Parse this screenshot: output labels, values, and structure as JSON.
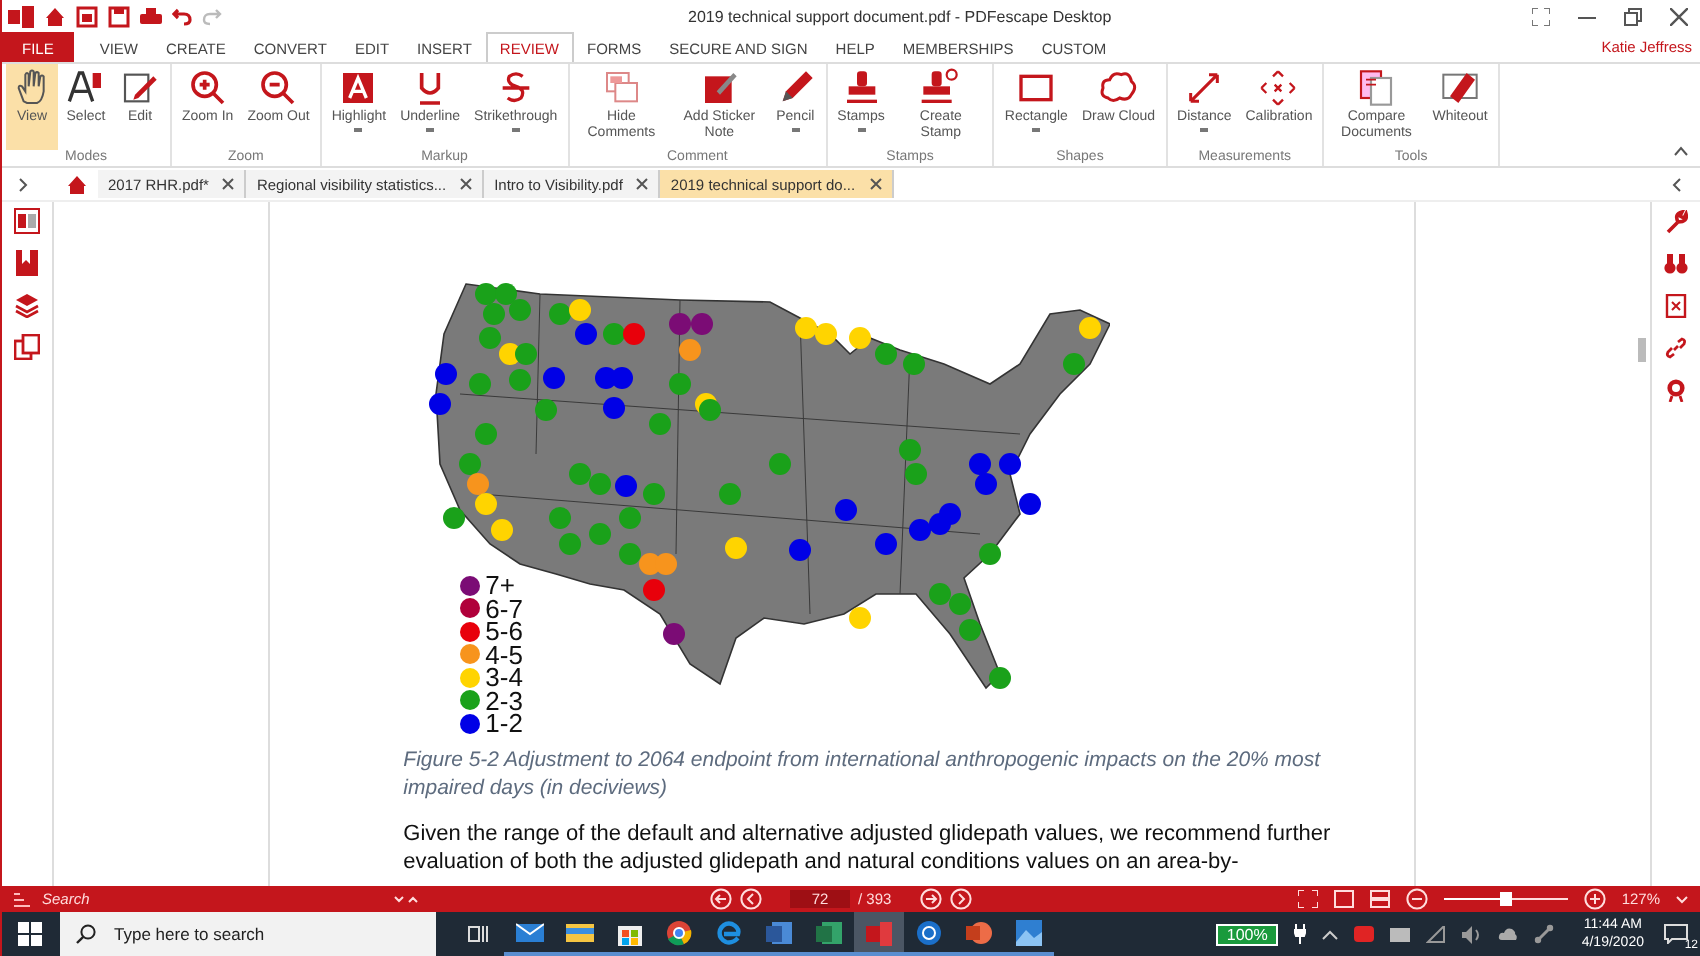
{
  "window": {
    "title": "2019 technical support document.pdf  -  PDFescape Desktop"
  },
  "menu": [
    {
      "label": "FILE",
      "kind": "file",
      "selected": false
    },
    {
      "label": "VIEW",
      "kind": "tab",
      "selected": false
    },
    {
      "label": "CREATE",
      "kind": "tab",
      "selected": false
    },
    {
      "label": "CONVERT",
      "kind": "tab",
      "selected": false
    },
    {
      "label": "EDIT",
      "kind": "tab",
      "selected": false
    },
    {
      "label": "INSERT",
      "kind": "tab",
      "selected": false
    },
    {
      "label": "REVIEW",
      "kind": "tab",
      "selected": true
    },
    {
      "label": "FORMS",
      "kind": "tab",
      "selected": false
    },
    {
      "label": "SECURE AND SIGN",
      "kind": "tab",
      "selected": false
    },
    {
      "label": "HELP",
      "kind": "tab",
      "selected": false
    },
    {
      "label": "MEMBERSHIPS",
      "kind": "tab",
      "selected": false
    },
    {
      "label": "CUSTOM",
      "kind": "tab",
      "selected": false
    }
  ],
  "user": "Katie Jeffress",
  "ribbon_groups": [
    {
      "label": "Modes",
      "tools": [
        {
          "label": "View",
          "kind": "hand",
          "selected": true,
          "dropdown": false
        },
        {
          "label": "Select",
          "kind": "select",
          "selected": false,
          "dropdown": false
        },
        {
          "label": "Edit",
          "kind": "edit",
          "selected": false,
          "dropdown": false
        }
      ]
    },
    {
      "label": "Zoom",
      "tools": [
        {
          "label": "Zoom In",
          "kind": "zoom-in",
          "selected": false,
          "dropdown": false
        },
        {
          "label": "Zoom Out",
          "kind": "zoom-out",
          "selected": false,
          "dropdown": false
        }
      ]
    },
    {
      "label": "Markup",
      "tools": [
        {
          "label": "Highlight",
          "kind": "highlight",
          "selected": false,
          "dropdown": true
        },
        {
          "label": "Underline",
          "kind": "underline",
          "selected": false,
          "dropdown": true
        },
        {
          "label": "Strikethrough",
          "kind": "strike",
          "selected": false,
          "dropdown": true
        }
      ]
    },
    {
      "label": "Comment",
      "tools": [
        {
          "label": "Hide Comments",
          "kind": "comments",
          "selected": false,
          "dropdown": false
        },
        {
          "label": "Add Sticker Note",
          "kind": "note",
          "selected": false,
          "dropdown": false
        },
        {
          "label": "Pencil",
          "kind": "pencil",
          "selected": false,
          "dropdown": true
        }
      ]
    },
    {
      "label": "Stamps",
      "tools": [
        {
          "label": "Stamps",
          "kind": "stamp",
          "selected": false,
          "dropdown": true
        },
        {
          "label": "Create Stamp",
          "kind": "create-stamp",
          "selected": false,
          "dropdown": false
        }
      ]
    },
    {
      "label": "Shapes",
      "tools": [
        {
          "label": "Rectangle",
          "kind": "rectangle",
          "selected": false,
          "dropdown": true
        },
        {
          "label": "Draw Cloud",
          "kind": "cloud",
          "selected": false,
          "dropdown": false
        }
      ]
    },
    {
      "label": "Measurements",
      "tools": [
        {
          "label": "Distance",
          "kind": "distance",
          "selected": false,
          "dropdown": true
        },
        {
          "label": "Calibration",
          "kind": "calibration",
          "selected": false,
          "dropdown": false
        }
      ]
    },
    {
      "label": "Tools",
      "tools": [
        {
          "label": "Compare Documents",
          "kind": "compare",
          "selected": false,
          "dropdown": false
        },
        {
          "label": "Whiteout",
          "kind": "whiteout",
          "selected": false,
          "dropdown": false
        }
      ]
    }
  ],
  "doc_tabs": [
    {
      "label": "2017 RHR.pdf*",
      "selected": false
    },
    {
      "label": "Regional visibility statistics...",
      "selected": false
    },
    {
      "label": "Intro to Visibility.pdf",
      "selected": false
    },
    {
      "label": "2019 technical support do...",
      "selected": true
    }
  ],
  "figure": {
    "legend": [
      {
        "label": "7+",
        "color": "#7b0c75"
      },
      {
        "label": "6-7",
        "color": "#b0003a"
      },
      {
        "label": "5-6",
        "color": "#e8000b"
      },
      {
        "label": "4-5",
        "color": "#f7941d"
      },
      {
        "label": "3-4",
        "color": "#ffd400"
      },
      {
        "label": "2-3",
        "color": "#1aa11a"
      },
      {
        "label": "1-2",
        "color": "#0000e6"
      }
    ],
    "caption": "Figure 5-2 Adjustment to 2064 endpoint from international anthropogenic impacts on the 20% most impaired days (in deciviews)",
    "body": "Given the range of the default and alternative adjusted glidepath values, we recommend further evaluation of both the adjusted glidepath and natural conditions values on an area-by-"
  },
  "status_bar": {
    "search_label": "Search",
    "page": "72",
    "total": "/ 393",
    "zoom_slider": {
      "level": 0.5
    },
    "zoom": "127%"
  },
  "taskbar": {
    "search_placeholder": "Type here to search",
    "battery": "100%",
    "time": "11:44 AM",
    "date": "4/19/2020",
    "notifications": "12"
  }
}
